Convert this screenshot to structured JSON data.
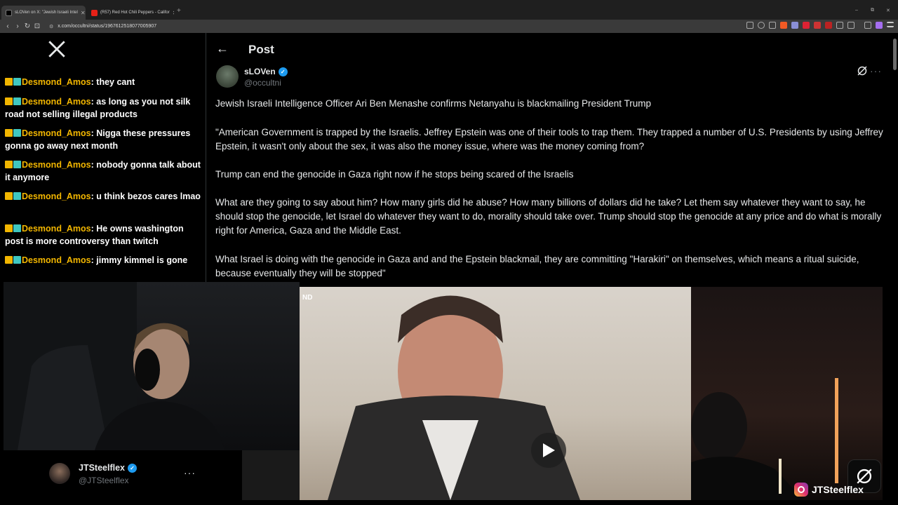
{
  "browser": {
    "tabs": [
      {
        "label": "sLOVen on X: \"Jewish Israeli Intel",
        "active": true,
        "favicon": "x-favicon"
      },
      {
        "label": "(R57) Red Hot Chili Peppers - Califor",
        "active": false,
        "favicon": "youtube-favicon"
      }
    ],
    "url": "x.com/occultni/status/1967612518077005907",
    "new_tab_label": "+",
    "window_controls": [
      "–",
      "⧉",
      "✕"
    ]
  },
  "chat": {
    "messages": [
      {
        "user": "Desmond_Amos",
        "text": "they cant"
      },
      {
        "user": "Desmond_Amos",
        "text": "as long as you not silk road not selling illegal products"
      },
      {
        "user": "Desmond_Amos",
        "text": "Nigga these pressures gonna go away next month"
      },
      {
        "user": "Desmond_Amos",
        "text": "nobody gonna talk about it anymore"
      },
      {
        "user": "Desmond_Amos",
        "text": "u think bezos cares lmao"
      },
      {
        "user": "Desmond_Amos",
        "text": "He owns washington post is more controversy than twitch"
      },
      {
        "user": "Desmond_Amos",
        "text": "jimmy kimmel is gone"
      }
    ]
  },
  "post": {
    "header_title": "Post",
    "author_name": "sLOVen",
    "author_handle": "@occultni",
    "paragraphs": [
      "Jewish Israeli Intelligence Officer Ari Ben Menashe confirms Netanyahu is blackmailing President Trump",
      "\"American Government is trapped by the Israelis. Jeffrey Epstein was one of their tools to trap them. They trapped a number of U.S. Presidents by using Jeffrey Epstein, it wasn't only about the sex, it was also the money issue, where was the money coming from?",
      "Trump can end the genocide in Gaza right now if he stops being scared of the Israelis",
      "What are they going to say about him? How many girls did he abuse? How many billions of dollars did he take? Let them say whatever they want to say, he should stop the genocide, let Israel do whatever they want to do, morality should take over. Trump should stop the genocide at any price and do what is morally right for America, Gaza and the Middle East.",
      "What Israel is doing with the genocide in Gaza and and the Epstein blackmail, they are committing \"Harakiri\" on themselves, which means a ritual suicide, because eventually they will be stopped\""
    ],
    "video_tag": "ND"
  },
  "profile": {
    "name": "JTSteelflex",
    "handle": "@JTSteelflex"
  },
  "watermark": {
    "instagram_handle": "JTSteelflex"
  },
  "colors": {
    "accent_blue": "#1d9bf0",
    "username_gold": "#f2b600",
    "muted_text": "#71767b",
    "background": "#000000"
  }
}
